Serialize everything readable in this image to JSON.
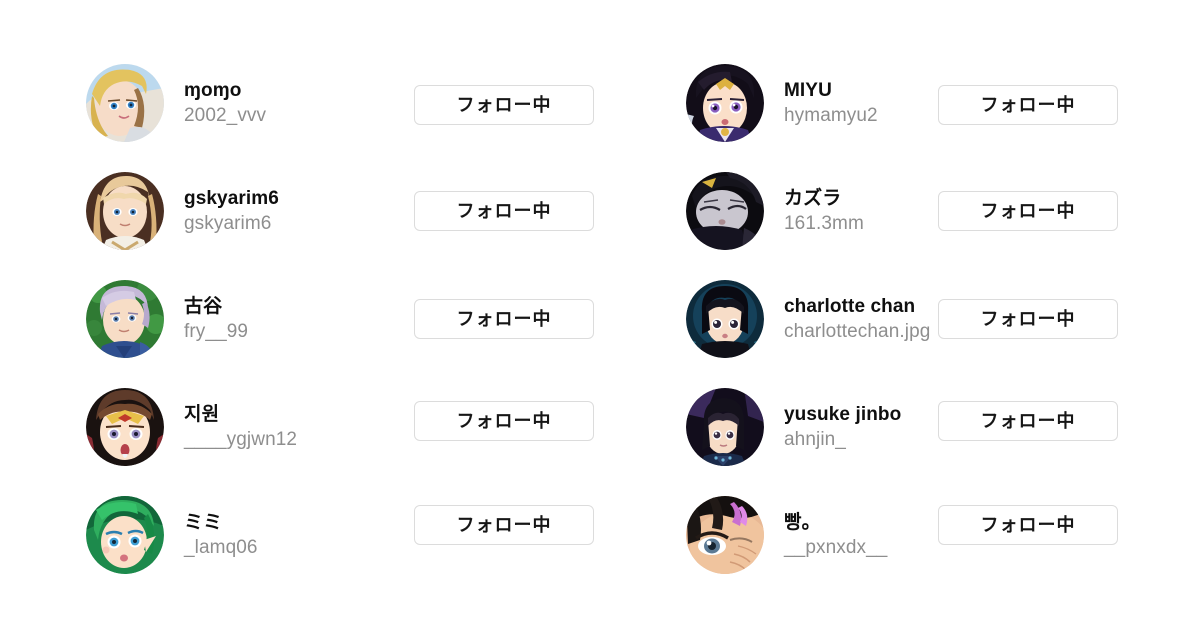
{
  "page": {
    "background_color": "#ffffff",
    "display_name_color": "#0f0f0f",
    "handle_color": "#8e8e8e",
    "button_border_color": "#dcdcdc",
    "button_text_color": "#161616",
    "columns": 2,
    "rows_per_column": 5
  },
  "follow_button": {
    "label": "フォロー中",
    "state": "following"
  },
  "columns": [
    {
      "name": "left-column",
      "users": [
        {
          "display_name": "ɱoɱo",
          "handle": "2002_vvv",
          "button_label": "フォロー中"
        },
        {
          "display_name": "gskyarim6",
          "handle": "gskyarim6",
          "button_label": "フォロー中"
        },
        {
          "display_name": "古谷",
          "handle": "fry__99",
          "button_label": "フォロー中"
        },
        {
          "display_name": "지원",
          "handle": "____ygjwn12",
          "button_label": "フォロー中"
        },
        {
          "display_name": "ミミ",
          "handle": "_lamq06",
          "button_label": "フォロー中"
        }
      ]
    },
    {
      "name": "right-column",
      "users": [
        {
          "display_name": "MIYU",
          "handle": "hymamyu2",
          "button_label": "フォロー中"
        },
        {
          "display_name": "カズラ",
          "handle": "161.3mm",
          "button_label": "フォロー中"
        },
        {
          "display_name": "charlotte chan",
          "handle": "charlottechan.jpg",
          "button_label": "フォロー中"
        },
        {
          "display_name": "yusuke jinbo",
          "handle": "ahnjin_",
          "button_label": "フォロー中"
        },
        {
          "display_name": "빵。",
          "handle": "__pxnxdx__",
          "button_label": "フォロー中"
        }
      ]
    }
  ]
}
